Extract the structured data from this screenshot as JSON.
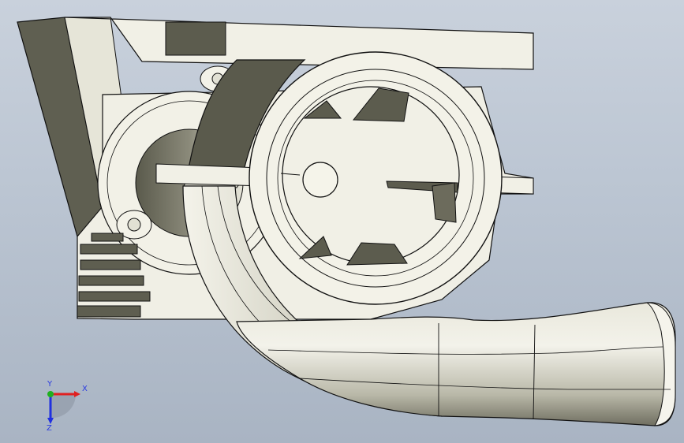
{
  "viewport": {
    "background_top": "#c9d1dc",
    "background_bottom": "#a9b4c3"
  },
  "model": {
    "description": "",
    "colors": {
      "part_light": "#f1f0e6",
      "part_shadow": "#5c5c4e",
      "edge": "#111111"
    }
  },
  "triad": {
    "x_label": "X",
    "y_label": "Y",
    "z_label": "Z",
    "x_color": "#e02020",
    "y_color": "#20b020",
    "z_color": "#2030e0"
  }
}
